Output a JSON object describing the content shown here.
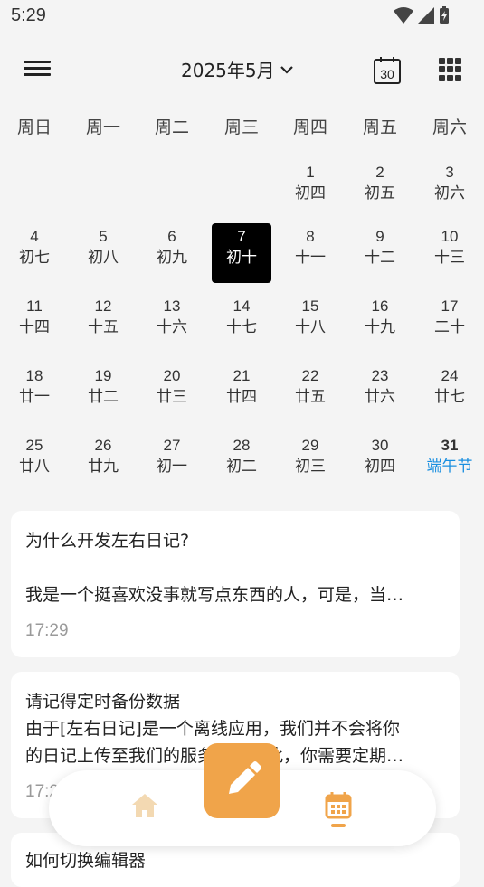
{
  "status_bar": {
    "time": "5:29"
  },
  "header": {
    "month_label": "2025年5月",
    "today_number": "30"
  },
  "weekdays": [
    "周日",
    "周一",
    "周二",
    "周三",
    "周四",
    "周五",
    "周六"
  ],
  "calendar": {
    "days": [
      {
        "n": "1",
        "l": "初四"
      },
      {
        "n": "2",
        "l": "初五"
      },
      {
        "n": "3",
        "l": "初六"
      },
      {
        "n": "4",
        "l": "初七"
      },
      {
        "n": "5",
        "l": "初八"
      },
      {
        "n": "6",
        "l": "初九"
      },
      {
        "n": "7",
        "l": "初十"
      },
      {
        "n": "8",
        "l": "十一"
      },
      {
        "n": "9",
        "l": "十二"
      },
      {
        "n": "10",
        "l": "十三"
      },
      {
        "n": "11",
        "l": "十四"
      },
      {
        "n": "12",
        "l": "十五"
      },
      {
        "n": "13",
        "l": "十六"
      },
      {
        "n": "14",
        "l": "十七"
      },
      {
        "n": "15",
        "l": "十八"
      },
      {
        "n": "16",
        "l": "十九"
      },
      {
        "n": "17",
        "l": "二十"
      },
      {
        "n": "18",
        "l": "廿一"
      },
      {
        "n": "19",
        "l": "廿二"
      },
      {
        "n": "20",
        "l": "廿三"
      },
      {
        "n": "21",
        "l": "廿四"
      },
      {
        "n": "22",
        "l": "廿五"
      },
      {
        "n": "23",
        "l": "廿六"
      },
      {
        "n": "24",
        "l": "廿七"
      },
      {
        "n": "25",
        "l": "廿八"
      },
      {
        "n": "26",
        "l": "廿九"
      },
      {
        "n": "27",
        "l": "初一"
      },
      {
        "n": "28",
        "l": "初二"
      },
      {
        "n": "29",
        "l": "初三"
      },
      {
        "n": "30",
        "l": "初四"
      },
      {
        "n": "31",
        "l": "端午节"
      }
    ],
    "selected_day": "7",
    "festival_day": "31",
    "festival_color": "#1a8fe0"
  },
  "entries": [
    {
      "line1": "为什么开发左右日记?",
      "line2": "",
      "line3": "我是一个挺喜欢没事就写点东西的人，可是，当…",
      "time": "17:29"
    },
    {
      "line1": "请记得定时备份数据",
      "line2": "由于[左右日记]是一个离线应用，我们并不会将你",
      "line3": "的日记上传至我们的服务器，因此，你需要定期…",
      "time": "17:29"
    },
    {
      "line1": "如何切换编辑器",
      "line2": "",
      "line3": "",
      "time": ""
    }
  ],
  "bottom_nav": {
    "home_icon": "home-icon",
    "calendar_icon": "calendar-icon",
    "accent": "#f0a44a"
  },
  "fab": {
    "icon": "pencil-icon",
    "color": "#f0a44a"
  }
}
